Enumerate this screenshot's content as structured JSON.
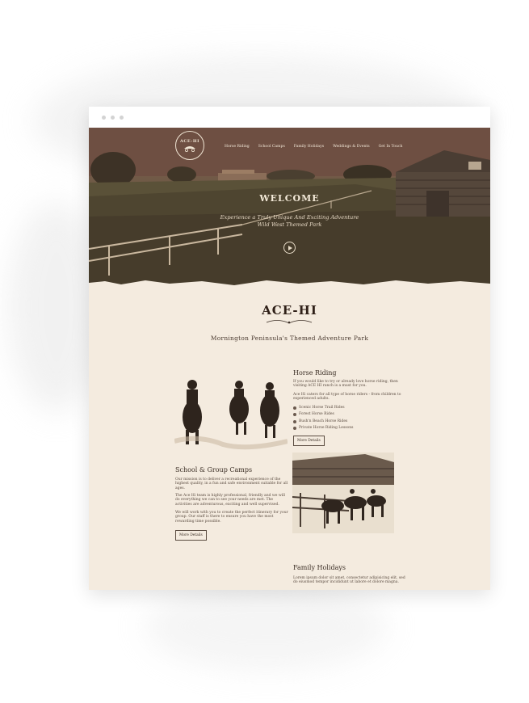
{
  "nav": [
    "Horse Riding",
    "School Camps",
    "Family Holidays",
    "Weddings & Events",
    "Get In Touch"
  ],
  "logo": {
    "text": "ACE-HI",
    "icon": "wagon-logo-icon"
  },
  "hero": {
    "title": "WELCOME",
    "subtitle_line1": "Experience a Truly Unique And Exciting Adventure",
    "subtitle_line2": "Wild West Themed Park",
    "play_icon": "play-icon"
  },
  "brand": {
    "name": "ACE-HI",
    "tagline": "Mornington Peninsula's Themed Adventure Park"
  },
  "horse_riding": {
    "title": "Horse Riding",
    "p1": "If you would like to try or already love horse riding, then visiting ACE HI ranch is a must for you.",
    "p2": "Ace Hi caters for all type of horse riders - from children to experienced adults.",
    "items": [
      "Scenic Horse Trail Rides",
      "Forest Horse Rides",
      "Bush'n Beach Horse Rides",
      "Private Horse Riding Lessons"
    ],
    "button": "More Details"
  },
  "school": {
    "title": "School & Group Camps",
    "p1": "Our mission is to deliver a recreational experience of the highest quality, in a fun and safe environment suitable for all ages.",
    "p2": "The Ace Hi team is highly professional, friendly and we will do everything we can to see your needs are met. The activities are adventurous, exciting and well supervised.",
    "p3": "We will work with you to create the perfect itinerary for your group. Our staff is there to ensure you have the most rewarding time possible.",
    "button": "More Details"
  },
  "family": {
    "title": "Family Holidays",
    "p1": "Lorem ipsum dolor sit amet, consectetur adipisicing elit, sed do eiusmod tempor incididunt ut labore et dolore magna."
  },
  "colors": {
    "page_bg": "#f4ebdf",
    "text": "#3b2e25",
    "hero": "#5a4a36"
  }
}
